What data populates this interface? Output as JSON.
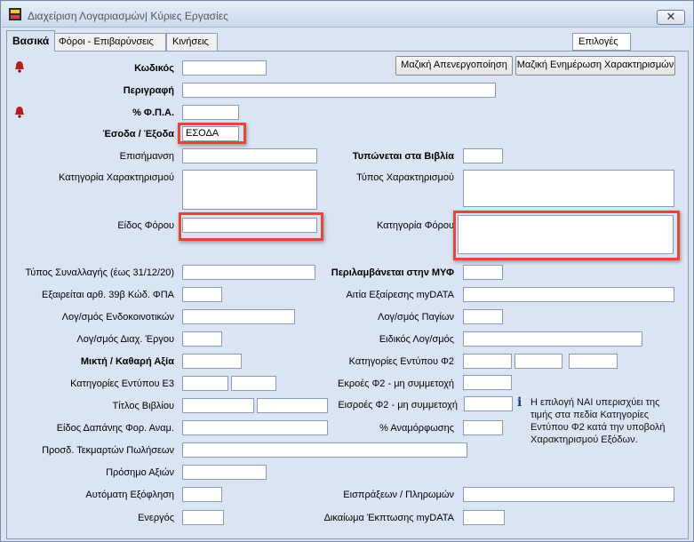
{
  "window": {
    "title": "Διαχείριση Λογαριασμών| Κύριες Εργασίες",
    "close_label": "✕"
  },
  "tabs": [
    {
      "label": "Βασικά",
      "active": true
    },
    {
      "label": "Φόροι - Επιβαρύνσεις",
      "active": false
    },
    {
      "label": "Κινήσεις",
      "active": false
    }
  ],
  "options_label": "Επιλογές",
  "buttons": {
    "mass_deactivate": "Μαζική Απενεργοποίηση",
    "mass_update": "Μαζική Ενημέρωση Χαρακτηρισμών"
  },
  "fields": {
    "code": {
      "label": "Κωδικός",
      "value": ""
    },
    "description": {
      "label": "Περιγραφή",
      "value": ""
    },
    "vat": {
      "label": "% Φ.Π.Α.",
      "value": ""
    },
    "income_expense": {
      "label": "Έσοδα / Έξοδα",
      "value": "ΕΣΟΔΑ"
    },
    "mark": {
      "label": "Επισήμανση",
      "value": ""
    },
    "printed_books": {
      "label": "Τυπώνεται στα Βιβλία",
      "value": ""
    },
    "char_category": {
      "label": "Κατηγορία Χαρακτηρισμού",
      "value": ""
    },
    "char_type": {
      "label": "Τύπος Χαρακτηρισμού",
      "value": ""
    },
    "tax_kind": {
      "label": "Είδος Φόρου",
      "value": ""
    },
    "tax_category": {
      "label": "Κατηγορία Φόρου",
      "value": ""
    },
    "transaction_type": {
      "label": "Τύπος Συναλλαγής (έως 31/12/20)",
      "value": ""
    },
    "included_myf": {
      "label": "Περιλαμβάνεται στην ΜΥΦ",
      "value": ""
    },
    "exempt_39b": {
      "label": "Εξαιρείται αρθ. 39β Κώδ. ΦΠΑ",
      "value": ""
    },
    "exempt_reason_mydata": {
      "label": "Αιτία Εξαίρεσης myDATA",
      "value": ""
    },
    "intra_community": {
      "label": "Λογ/σμός Ενδοκοινοτικών",
      "value": ""
    },
    "fixed_assets": {
      "label": "Λογ/σμός  Παγίων",
      "value": ""
    },
    "work_management": {
      "label": "Λογ/σμός Διαχ. Έργου",
      "value": ""
    },
    "special_account": {
      "label": "Ειδικός Λογ/σμός",
      "value": ""
    },
    "gross_net": {
      "label": "Μικτή  / Καθαρή Αξία",
      "value": ""
    },
    "f2_categories": {
      "label": "Κατηγορίες Εντύπου Φ2",
      "values": [
        "",
        "",
        ""
      ]
    },
    "e3_categories": {
      "label": "Κατηγορίες Εντύπου Ε3",
      "values": [
        "",
        ""
      ]
    },
    "f2_outflows": {
      "label": "Εκροές Φ2 - μη συμμετοχή",
      "value": ""
    },
    "book_title": {
      "label": "Τίτλος Βιβλίου",
      "values": [
        "",
        ""
      ]
    },
    "f2_inflows": {
      "label": "Εισροές Φ2 - μη συμμετοχή",
      "value": ""
    },
    "expense_kind": {
      "label": "Είδος Δαπάνης Φορ. Αναμ.",
      "value": ""
    },
    "adjustment_pct": {
      "label": "% Αναμόρφωσης",
      "value": ""
    },
    "sales_evidence": {
      "label": "Προσδ. Τεκμαρτών Πωλήσεων",
      "value": ""
    },
    "value_sign": {
      "label": "Πρόσημο Αξιών",
      "value": ""
    },
    "auto_settlement": {
      "label": "Αυτόματη Εξόφληση",
      "value": ""
    },
    "receipts_payments": {
      "label": "Εισπράξεων / Πληρωμών",
      "value": ""
    },
    "active": {
      "label": "Ενεργός",
      "value": ""
    },
    "deduction_right": {
      "label": "Δικαίωμα Έκπτωσης myDATA",
      "value": ""
    }
  },
  "info_note": "Η επιλογή ΝΑΙ υπερισχύει της τιμής στα πεδία Κατηγορίες Εντύπου Φ2 κατά την υποβολή Χαρακτηρισμού Εξόδων.",
  "colors": {
    "highlight": "#e2473a",
    "panel": "#dbe4f2"
  }
}
